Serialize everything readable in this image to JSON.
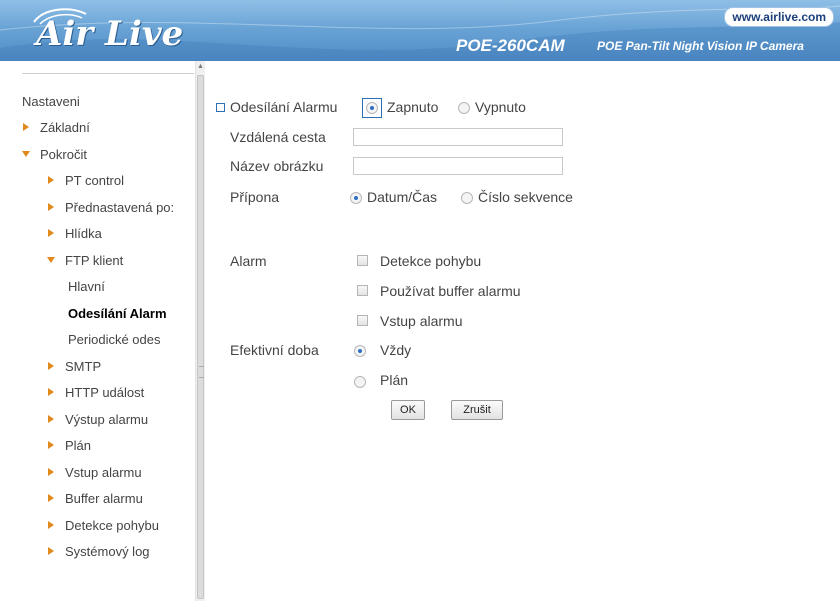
{
  "header": {
    "logo_text": "Air Live",
    "url_badge": "www.airlive.com",
    "model": "POE-260CAM",
    "subtitle": "POE Pan-Tilt Night Vision IP Camera",
    "accent_color": "#4f8ac4"
  },
  "sidebar": {
    "root_label": "Nastaveni",
    "items": [
      {
        "label": "Základní",
        "arrow": "right",
        "level": 1
      },
      {
        "label": "Pokročit",
        "arrow": "down",
        "level": 1
      },
      {
        "label": "PT control",
        "arrow": "right",
        "level": 2
      },
      {
        "label": "Přednastavená po:",
        "arrow": "right",
        "level": 2
      },
      {
        "label": "Hlídka",
        "arrow": "right",
        "level": 2
      },
      {
        "label": "FTP klient",
        "arrow": "down",
        "level": 2
      },
      {
        "label": "Hlavní",
        "arrow": "none",
        "level": 3
      },
      {
        "label": "Odesílání Alarm",
        "arrow": "none",
        "level": 3,
        "selected": true
      },
      {
        "label": "Periodické odes",
        "arrow": "none",
        "level": 3
      },
      {
        "label": "SMTP",
        "arrow": "right",
        "level": 2
      },
      {
        "label": "HTTP událost",
        "arrow": "right",
        "level": 2
      },
      {
        "label": "Výstup alarmu",
        "arrow": "right",
        "level": 2
      },
      {
        "label": "Plán",
        "arrow": "right",
        "level": 2
      },
      {
        "label": "Vstup alarmu",
        "arrow": "right",
        "level": 2
      },
      {
        "label": "Buffer alarmu",
        "arrow": "right",
        "level": 2
      },
      {
        "label": "Detekce pohybu",
        "arrow": "right",
        "level": 2
      },
      {
        "label": "Systémový log",
        "arrow": "right",
        "level": 2
      }
    ]
  },
  "form": {
    "title": "Odesílání Alarmu",
    "enable_on_label": "Zapnuto",
    "enable_off_label": "Vypnuto",
    "enabled": true,
    "remote_path_label": "Vzdálená cesta",
    "remote_path_value": "",
    "image_name_label": "Název obrázku",
    "image_name_value": "",
    "suffix_label": "Přípona",
    "suffix_options": [
      "Datum/Čas",
      "Číslo sekvence"
    ],
    "suffix_selected": "Datum/Čas",
    "alarm_label": "Alarm",
    "alarm_options": [
      "Detekce pohybu",
      "Používat buffer alarmu",
      "Vstup alarmu"
    ],
    "effective_label": "Efektivní doba",
    "effective_options": [
      "Vždy",
      "Plán"
    ],
    "effective_selected": "Vždy",
    "ok_label": "OK",
    "cancel_label": "Zrušit"
  }
}
